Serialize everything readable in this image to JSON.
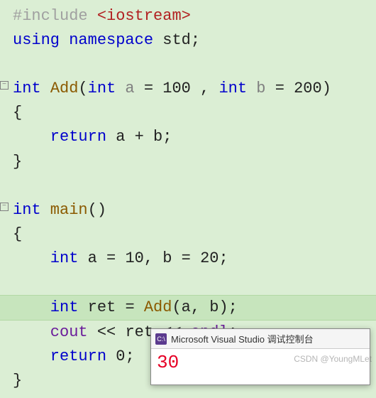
{
  "code": {
    "l1_pre": "#include",
    "l1_path": "<iostream>",
    "l2_kw": "using namespace",
    "l2_id": " std;",
    "l4_type": "int",
    "l4_fn": "Add",
    "l4_open": "(",
    "l4_p1t": "int",
    "l4_p1n": " a ",
    "l4_eq1": "= ",
    "l4_v1": "100",
    "l4_comma": " , ",
    "l4_p2t": "int",
    "l4_p2n": " b ",
    "l4_eq2": "= ",
    "l4_v2": "200",
    "l4_close": ")",
    "l5": "{",
    "l6_kw": "    return",
    "l6_exp_a": " a ",
    "l6_plus": "+ ",
    "l6_exp_b": "b",
    "l6_semi": ";",
    "l7": "}",
    "l9_type": "int",
    "l9_fn": " main",
    "l9_par": "()",
    "l10": "{",
    "l11_type": "    int",
    "l11_a": " a ",
    "l11_eq1": "= ",
    "l11_v1": "10",
    "l11_c": ", ",
    "l11_b": "b ",
    "l11_eq2": "= ",
    "l11_v2": "20",
    "l11_s": ";",
    "l13_type": "    int",
    "l13_r": " ret ",
    "l13_eq": "= ",
    "l13_fn": "Add",
    "l13_args": "(a, b);",
    "l14_cout": "    cout ",
    "l14_op1": "<< ",
    "l14_r": "ret ",
    "l14_op2": "<< ",
    "l14_endl": "endl",
    "l14_s": ";",
    "l15_kw": "    return",
    "l15_v": " 0",
    "l15_s": ";",
    "l16": "}"
  },
  "console": {
    "icon": "C:\\",
    "title": "Microsoft Visual Studio 调试控制台",
    "output": "30"
  },
  "watermark": "CSDN @YoungMLet",
  "fold": "−"
}
